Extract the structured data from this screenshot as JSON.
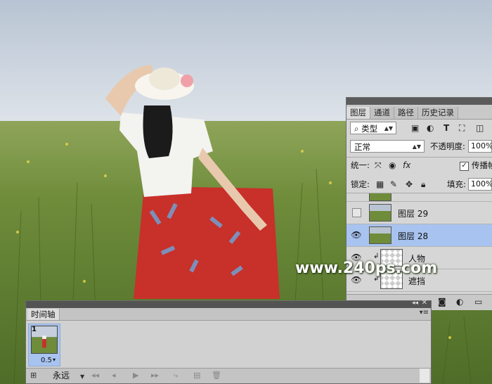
{
  "layers_panel": {
    "tabs": [
      "图层",
      "通道",
      "路径",
      "历史记录"
    ],
    "filter_type": "类型",
    "blend_mode": "正常",
    "opacity_label": "不透明度:",
    "opacity_value": "100%",
    "unify_label": "统一:",
    "propagate_label": "传播帧",
    "lock_label": "锁定:",
    "fill_label": "填充:",
    "fill_value": "100%",
    "layers": [
      {
        "name": "图层 29",
        "visible": false,
        "selected": false
      },
      {
        "name": "图层 28",
        "visible": true,
        "selected": true
      },
      {
        "name": "人物",
        "visible": true,
        "selected": false
      },
      {
        "name": "遮挡",
        "visible": true,
        "selected": false
      }
    ]
  },
  "timeline": {
    "tab_label": "时间轴",
    "frame_number": "1",
    "frame_delay": "0.5",
    "loop_option": "永远"
  },
  "watermark": "www.240ps.com",
  "colors": {
    "selection": "#a8c3ef",
    "panel": "#d6d6d6"
  }
}
